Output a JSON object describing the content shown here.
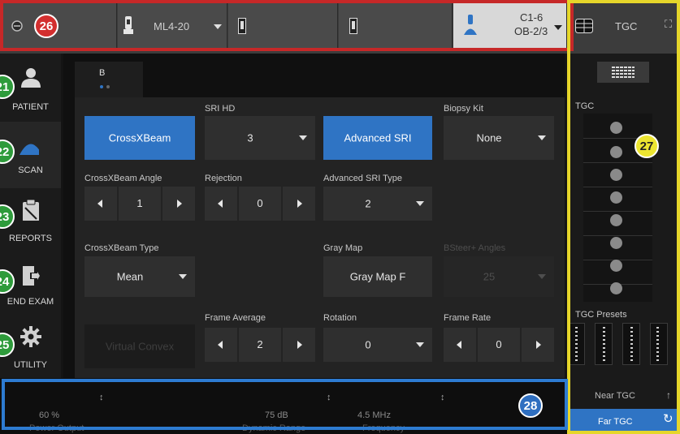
{
  "topbar": {
    "probe1": "ML4-20",
    "probe_active_line1": "C1-6",
    "probe_active_line2": "OB-2/3",
    "tgc_label": "TGC"
  },
  "sidebar": {
    "items": [
      {
        "label": "PATIENT",
        "icon": "person-icon"
      },
      {
        "label": "SCAN",
        "icon": "scan-icon"
      },
      {
        "label": "REPORTS",
        "icon": "clipboard-icon"
      },
      {
        "label": "END EXAM",
        "icon": "exit-icon"
      },
      {
        "label": "UTILITY",
        "icon": "gear-icon"
      }
    ]
  },
  "main": {
    "tab_label": "B",
    "crossxbeam_button": "CrossXBeam",
    "sri_hd_label": "SRI HD",
    "sri_hd_value": "3",
    "advanced_sri_button": "Advanced SRI",
    "biopsy_kit_label": "Biopsy Kit",
    "biopsy_kit_value": "None",
    "crossxbeam_angle_label": "CrossXBeam Angle",
    "crossxbeam_angle_value": "1",
    "rejection_label": "Rejection",
    "rejection_value": "0",
    "advanced_sri_type_label": "Advanced SRI Type",
    "advanced_sri_type_value": "2",
    "crossxbeam_type_label": "CrossXBeam Type",
    "crossxbeam_type_value": "Mean",
    "gray_map_label": "Gray Map",
    "gray_map_value": "Gray Map F",
    "bsteer_label": "BSteer+ Angles",
    "bsteer_value": "25",
    "frame_average_label": "Frame Average",
    "frame_average_value": "2",
    "rotation_label": "Rotation",
    "rotation_value": "0",
    "frame_rate_label": "Frame Rate",
    "frame_rate_value": "0",
    "virtual_convex_button": "Virtual Convex"
  },
  "bottom": {
    "power_output_value": "60 %",
    "power_output_label": "Power Output",
    "dynamic_range_value": "75 dB",
    "dynamic_range_label": "Dynamic Range",
    "frequency_value": "4.5 MHz",
    "frequency_label": "Frequency"
  },
  "right": {
    "tgc_title": "TGC",
    "tgc_presets_title": "TGC Presets",
    "near_tgc": "Near TGC",
    "far_tgc": "Far TGC"
  },
  "annotations": {
    "b21": "21",
    "b22": "22",
    "b23": "23",
    "b24": "24",
    "b25": "25",
    "b26": "26",
    "b27": "27",
    "b28": "28"
  },
  "colors": {
    "accent_blue": "#2f74c4",
    "frame_red": "#c62828",
    "frame_yellow": "#e6d62a",
    "frame_blue": "#2d7bd1",
    "badge_green": "#2e9b3b"
  }
}
